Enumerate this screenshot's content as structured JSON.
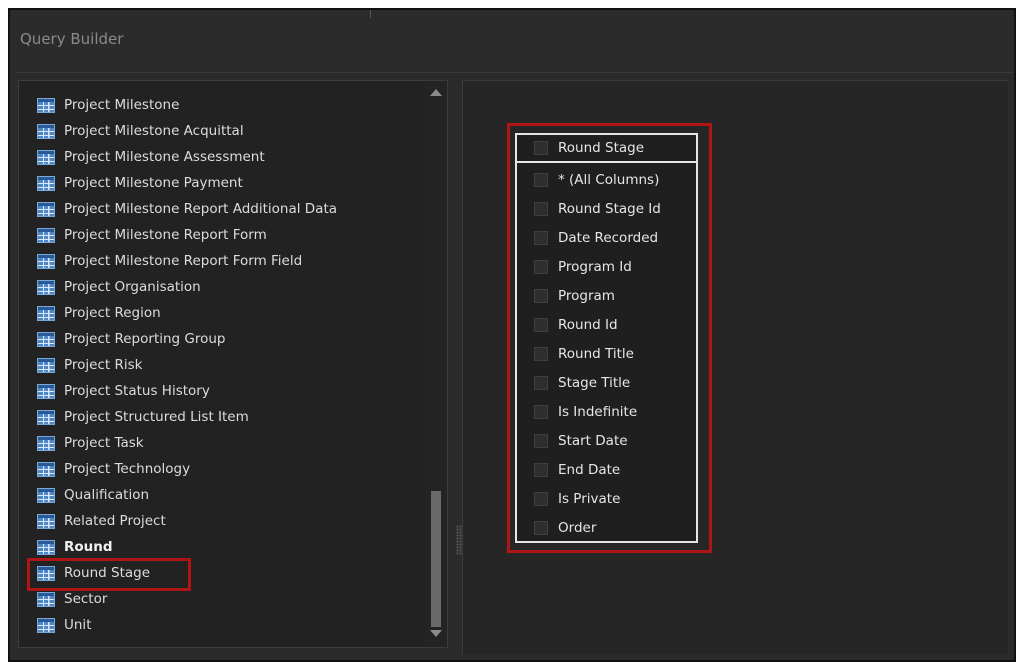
{
  "window": {
    "title": "Query Builder"
  },
  "colors": {
    "highlight": "#b01515",
    "background": "#2b2b2b",
    "table_icon": "#4f86c6"
  },
  "tables_list": {
    "icon": "table-grid-icon",
    "items": [
      {
        "label": "Project Milestone",
        "bold": false
      },
      {
        "label": "Project Milestone Acquittal",
        "bold": false
      },
      {
        "label": "Project Milestone Assessment",
        "bold": false
      },
      {
        "label": "Project Milestone Payment",
        "bold": false
      },
      {
        "label": "Project Milestone Report Additional Data",
        "bold": false
      },
      {
        "label": "Project Milestone Report Form",
        "bold": false
      },
      {
        "label": "Project Milestone Report Form Field",
        "bold": false
      },
      {
        "label": "Project Organisation",
        "bold": false
      },
      {
        "label": "Project Region",
        "bold": false
      },
      {
        "label": "Project Reporting Group",
        "bold": false
      },
      {
        "label": "Project Risk",
        "bold": false
      },
      {
        "label": "Project Status History",
        "bold": false
      },
      {
        "label": "Project Structured List Item",
        "bold": false
      },
      {
        "label": "Project Task",
        "bold": false
      },
      {
        "label": "Project Technology",
        "bold": false
      },
      {
        "label": "Qualification",
        "bold": false
      },
      {
        "label": "Related Project",
        "bold": false
      },
      {
        "label": "Round",
        "bold": true
      },
      {
        "label": "Round Stage",
        "bold": false,
        "highlighted": true
      },
      {
        "label": "Sector",
        "bold": false
      },
      {
        "label": "Unit",
        "bold": false
      }
    ]
  },
  "table_box": {
    "title": "Round Stage",
    "title_checked": false,
    "columns": [
      {
        "label": "* (All Columns)",
        "checked": false
      },
      {
        "label": "Round Stage Id",
        "checked": false
      },
      {
        "label": "Date Recorded",
        "checked": false
      },
      {
        "label": "Program Id",
        "checked": false
      },
      {
        "label": "Program",
        "checked": false
      },
      {
        "label": "Round Id",
        "checked": false
      },
      {
        "label": "Round Title",
        "checked": false
      },
      {
        "label": "Stage Title",
        "checked": false
      },
      {
        "label": "Is Indefinite",
        "checked": false
      },
      {
        "label": "Start Date",
        "checked": false
      },
      {
        "label": "End Date",
        "checked": false
      },
      {
        "label": "Is Private",
        "checked": false
      },
      {
        "label": "Order",
        "checked": false
      }
    ]
  }
}
